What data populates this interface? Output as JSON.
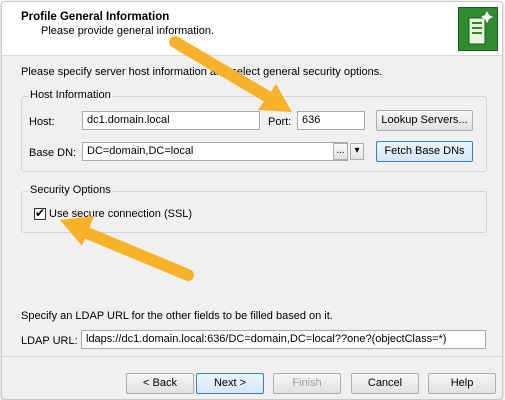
{
  "header": {
    "title": "Profile General Information",
    "subtitle": "Please provide general information."
  },
  "intro_text": "Please specify server host information and select general security options.",
  "host_info": {
    "group_label": "Host Information",
    "host_label": "Host:",
    "host_value": "dc1.domain.local",
    "port_label": "Port:",
    "port_value": "636",
    "lookup_button": "Lookup Servers...",
    "basedn_label": "Base DN:",
    "basedn_value": "DC=domain,DC=local",
    "browse_button": "...",
    "fetch_button": "Fetch Base DNs"
  },
  "security": {
    "group_label": "Security Options",
    "ssl_label": "Use secure connection (SSL)",
    "ssl_checked": true
  },
  "ldap": {
    "hint": "Specify an LDAP URL for the other fields to be filled based on it.",
    "label": "LDAP URL:",
    "value": "ldaps://dc1.domain.local:636/DC=domain,DC=local??one?(objectClass=*)"
  },
  "footer": {
    "back": "< Back",
    "next": "Next >",
    "finish": "Finish",
    "cancel": "Cancel",
    "help": "Help"
  },
  "colors": {
    "arrow": "#f7b22a",
    "logo": "#2e8b2e",
    "focus_border": "#3c7fb1"
  }
}
